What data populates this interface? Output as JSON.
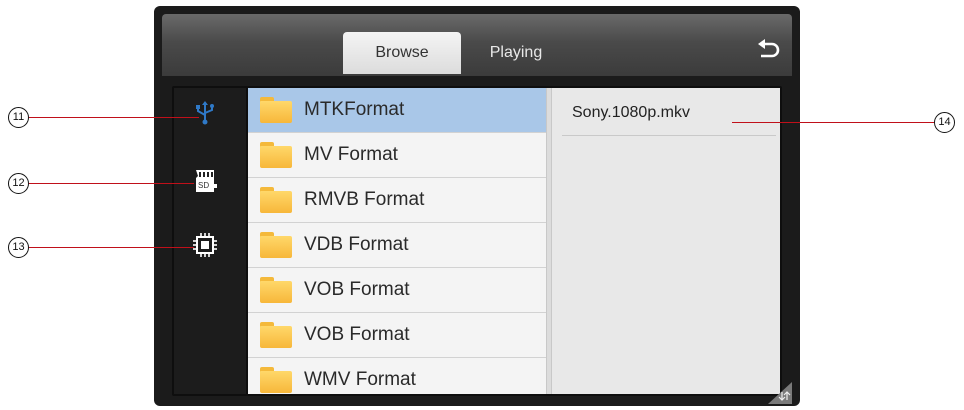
{
  "tabs": {
    "browse": "Browse",
    "playing": "Playing"
  },
  "sources": {
    "usb_icon": "usb-icon",
    "sd_icon": "sd-card-icon",
    "sd_text": "SD",
    "internal_icon": "chip-icon"
  },
  "folders": [
    {
      "label": "MTKFormat",
      "selected": true
    },
    {
      "label": "MV Format"
    },
    {
      "label": "RMVB Format"
    },
    {
      "label": "VDB Format"
    },
    {
      "label": "VOB Format"
    },
    {
      "label": "VOB Format"
    },
    {
      "label": "WMV Format"
    }
  ],
  "files": [
    {
      "name": "Sony.1080p.mkv"
    }
  ],
  "callouts": {
    "c11": "11",
    "c12": "12",
    "c13": "13",
    "c14": "14"
  },
  "colors": {
    "accent_usb": "#2f79c7",
    "selected_row": "#a9c7e8",
    "folder": "#f7b73a",
    "callout_line": "#c0101a"
  }
}
